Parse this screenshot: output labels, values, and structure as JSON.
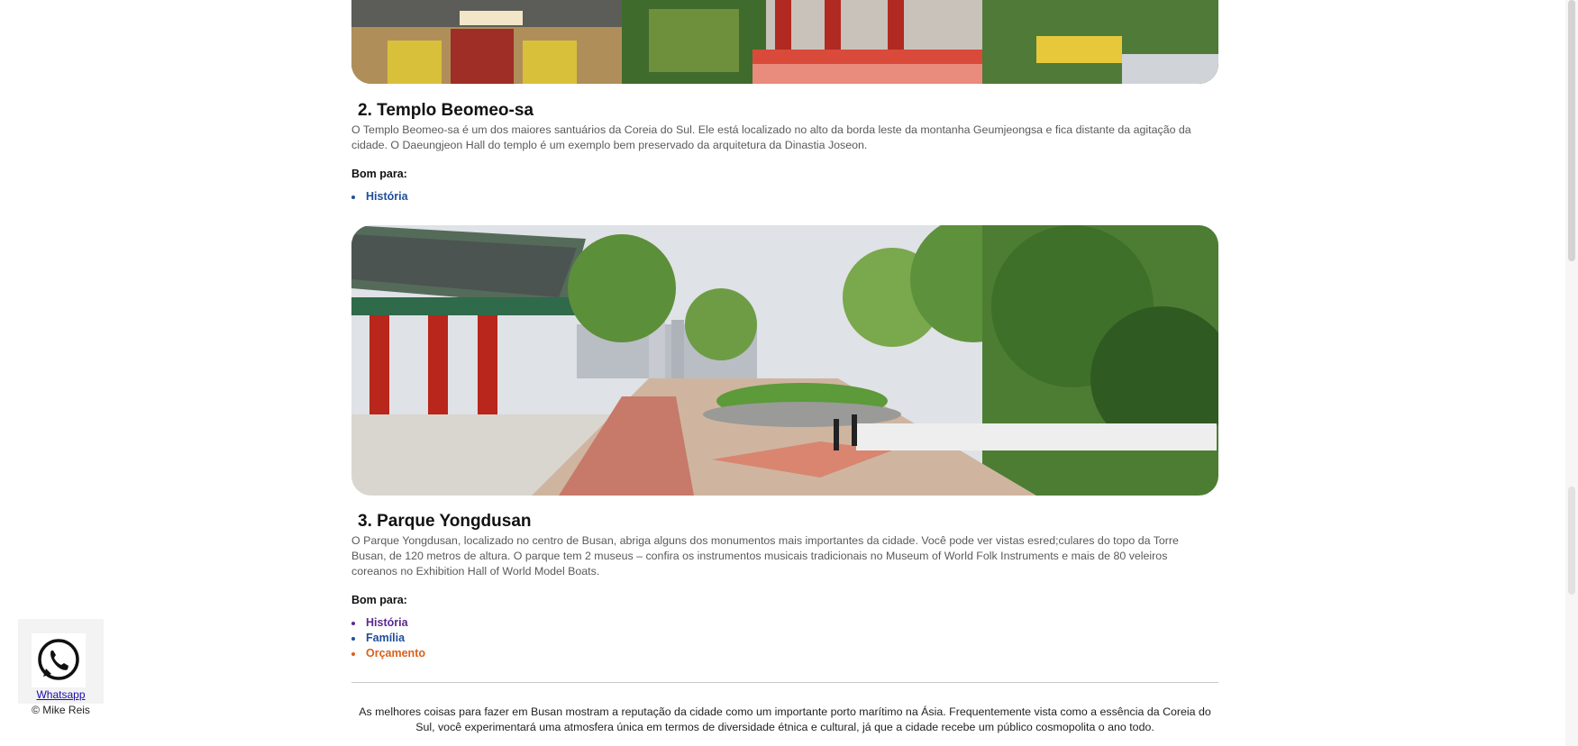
{
  "sections": [
    {
      "title": "2. Templo Beomeo-sa",
      "text": "O Templo Beomeo-sa é um dos maiores santuários da Coreia do Sul. Ele está localizado no alto da borda leste da montanha Geumjeongsa e fica distante da agitação da cidade. O Daeungjeon Hall do templo é um exemplo bem preservado da arquitetura da Dinastia Joseon.",
      "bom_label": "Bom para:",
      "tags": [
        {
          "label": "História",
          "color": "#1f4e9a"
        }
      ]
    },
    {
      "title": "3. Parque Yongdusan",
      "text": "O Parque Yongdusan, localizado no centro de Busan, abriga alguns dos monumentos mais importantes da cidade. Você pode ver vistas esred;culares do topo da Torre Busan, de 120 metros de altura. O parque tem 2 museus – confira os instrumentos musicais tradicionais no Museum of World Folk Instruments e mais de 80 veleiros coreanos no Exhibition Hall of World Model Boats.",
      "bom_label": "Bom para:",
      "tags": [
        {
          "label": "História",
          "color": "#5a2a8f"
        },
        {
          "label": "Família",
          "color": "#1f4e9a"
        },
        {
          "label": "Orçamento",
          "color": "#d9601a"
        }
      ]
    }
  ],
  "summary": "As melhores coisas para fazer em Busan mostram a reputação da cidade como um importante porto marítimo na Ásia. Frequentemente vista como a essência da Coreia do Sul, você experimentará uma atmosfera única em termos de diversidade étnica e cultural, já que a cidade recebe um público cosmopolita o ano todo.",
  "whatsapp": {
    "link_label": "Whatsapp",
    "copyright": "© Mike Reis",
    "icon": "whatsapp-phone-icon"
  },
  "images": [
    {
      "name": "temple-beomeo-sa-photo",
      "icon": "photo-temple"
    },
    {
      "name": "yongdusan-park-photo",
      "icon": "photo-park"
    }
  ],
  "colors": {
    "heading": "#111111",
    "body_text": "#5a5a5a",
    "link": "#1a0dab"
  }
}
